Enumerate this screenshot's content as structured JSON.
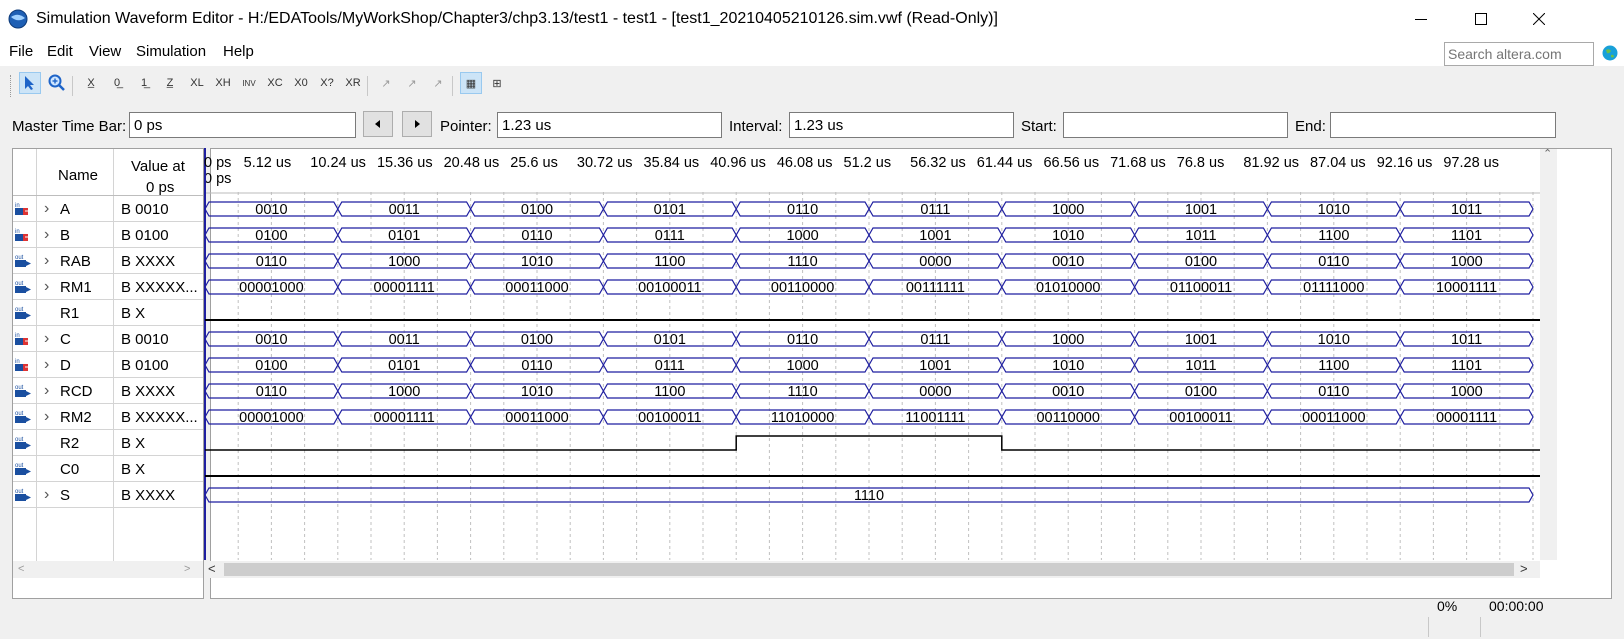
{
  "window": {
    "title": "Simulation Waveform Editor - H:/EDATools/MyWorkShop/Chapter3/chp3.13/test1 - test1 - [test1_20210405210126.sim.vwf (Read-Only)]"
  },
  "menu": [
    "File",
    "Edit",
    "View",
    "Simulation",
    "Help"
  ],
  "search": {
    "placeholder": "Search altera.com"
  },
  "toolbar": {
    "icons": [
      "selection-tool-icon",
      "zoom-tool-icon",
      "unknown-value-icon",
      "forcing-low-icon",
      "forcing-high-icon",
      "high-impedance-icon",
      "weak-low-icon",
      "weak-high-icon",
      "invert-icon",
      "count-value-icon",
      "overwrite-clock-icon",
      "dont-care-icon",
      "random-values-icon",
      "snap-to-grid-icon",
      "arbitrary-value-icon",
      "reverse-icon",
      "waveform-view-icon",
      "grid-icon"
    ]
  },
  "timebar": {
    "master_label": "Master Time Bar:",
    "master_value": "0 ps",
    "pointer_label": "Pointer:",
    "pointer_value": "1.23 us",
    "interval_label": "Interval:",
    "interval_value": "1.23 us",
    "start_label": "Start:",
    "start_value": "",
    "end_label": "End:",
    "end_value": ""
  },
  "columns": {
    "name": "Name",
    "value_line1": "Value at",
    "value_line2": "0 ps"
  },
  "time_ticks": [
    "0 ps",
    "5.12 us",
    "10.24 us",
    "15.36 us",
    "20.48 us",
    "25.6 us",
    "30.72 us",
    "35.84 us",
    "40.96 us",
    "46.08 us",
    "51.2 us",
    "56.32 us",
    "61.44 us",
    "66.56 us",
    "71.68 us",
    "76.8 us",
    "81.92 us",
    "87.04 us",
    "92.16 us",
    "97.28 us"
  ],
  "cursor_label": "0 ps",
  "signals": [
    {
      "name": "A",
      "dir": "in",
      "value": "B 0010",
      "expandable": true,
      "type": "bus",
      "segments": [
        "0010",
        "0011",
        "0100",
        "0101",
        "0110",
        "0111",
        "1000",
        "1001",
        "1010",
        "1011"
      ]
    },
    {
      "name": "B",
      "dir": "in",
      "value": "B 0100",
      "expandable": true,
      "type": "bus",
      "segments": [
        "0100",
        "0101",
        "0110",
        "0111",
        "1000",
        "1001",
        "1010",
        "1011",
        "1100",
        "1101"
      ]
    },
    {
      "name": "RAB",
      "dir": "out",
      "value": "B XXXX",
      "expandable": true,
      "type": "bus",
      "segments": [
        "0110",
        "1000",
        "1010",
        "1100",
        "1110",
        "0000",
        "0010",
        "0100",
        "0110",
        "1000"
      ]
    },
    {
      "name": "RM1",
      "dir": "out",
      "value": "B XXXXX...",
      "expandable": true,
      "type": "bus",
      "segments": [
        "00001000",
        "00001111",
        "00011000",
        "00100011",
        "00110000",
        "00111111",
        "01010000",
        "01100011",
        "01111000",
        "10001111"
      ]
    },
    {
      "name": "R1",
      "dir": "out",
      "value": "B X",
      "expandable": false,
      "type": "bit",
      "levels": [
        0,
        0,
        0,
        0,
        0,
        0,
        0,
        0,
        0,
        0
      ]
    },
    {
      "name": "C",
      "dir": "in",
      "value": "B 0010",
      "expandable": true,
      "type": "bus",
      "segments": [
        "0010",
        "0011",
        "0100",
        "0101",
        "0110",
        "0111",
        "1000",
        "1001",
        "1010",
        "1011"
      ]
    },
    {
      "name": "D",
      "dir": "in",
      "value": "B 0100",
      "expandable": true,
      "type": "bus",
      "segments": [
        "0100",
        "0101",
        "0110",
        "0111",
        "1000",
        "1001",
        "1010",
        "1011",
        "1100",
        "1101"
      ]
    },
    {
      "name": "RCD",
      "dir": "out",
      "value": "B XXXX",
      "expandable": true,
      "type": "bus",
      "segments": [
        "0110",
        "1000",
        "1010",
        "1100",
        "1110",
        "0000",
        "0010",
        "0100",
        "0110",
        "1000"
      ]
    },
    {
      "name": "RM2",
      "dir": "out",
      "value": "B XXXXX...",
      "expandable": true,
      "type": "bus",
      "segments": [
        "00001000",
        "00001111",
        "00011000",
        "00100011",
        "11010000",
        "11001111",
        "00110000",
        "00100011",
        "00011000",
        "00001111"
      ]
    },
    {
      "name": "R2",
      "dir": "out",
      "value": "B X",
      "expandable": false,
      "type": "bit",
      "levels": [
        0,
        0,
        0,
        0,
        1,
        1,
        0,
        0,
        0,
        0
      ]
    },
    {
      "name": "C0",
      "dir": "out",
      "value": "B X",
      "expandable": false,
      "type": "bit",
      "levels": [
        0,
        0,
        0,
        0,
        0,
        0,
        0,
        0,
        0,
        0
      ]
    },
    {
      "name": "S",
      "dir": "out",
      "value": "B XXXX",
      "expandable": true,
      "type": "bus",
      "segments": [
        "1110"
      ]
    }
  ],
  "status": {
    "progress": "0%",
    "elapsed": "00:00:00"
  },
  "colors": {
    "wave": "#1f1fa0",
    "bit": "#000000",
    "grid": "#c0c0c0",
    "input_icon": "#1a4fa0",
    "output_icon": "#1a4fa0"
  }
}
